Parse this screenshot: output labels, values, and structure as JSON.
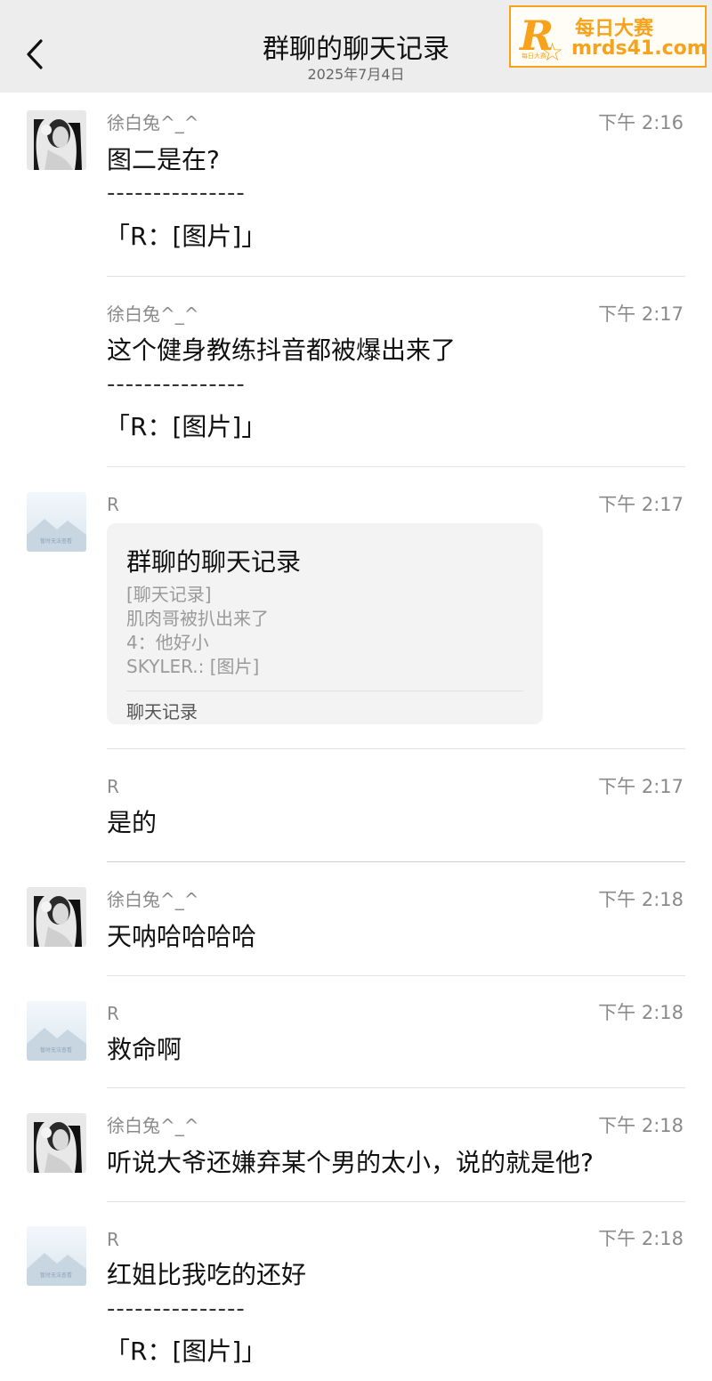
{
  "header": {
    "title": "群聊的聊天记录",
    "date": "2025年7月4日"
  },
  "watermark": {
    "logo_letter": "R",
    "logo_small": "每日大赛",
    "name": "每日大赛",
    "url": "mrds41.com"
  },
  "messages": [
    {
      "sender": "徐白兔^_^",
      "time": "下午 2:16",
      "text": "图二是在?",
      "divider": "---------------",
      "quote": "「R：[图片]」"
    },
    {
      "sender": "徐白兔^_^",
      "time": "下午 2:17",
      "text": "这个健身教练抖音都被爆出来了",
      "divider": "---------------",
      "quote": "「R：[图片]」"
    },
    {
      "sender": "R",
      "time": "下午 2:17",
      "card": {
        "title": "群聊的聊天记录",
        "lines": [
          "[聊天记录]",
          "肌肉哥被扒出来了",
          "4：他好小",
          "SKYLER.: [图片]"
        ],
        "footer": "聊天记录"
      }
    },
    {
      "sender": "R",
      "time": "下午 2:17",
      "text": "是的"
    },
    {
      "sender": "徐白兔^_^",
      "time": "下午 2:18",
      "text": "天呐哈哈哈哈"
    },
    {
      "sender": "R",
      "time": "下午 2:18",
      "text": "救命啊"
    },
    {
      "sender": "徐白兔^_^",
      "time": "下午 2:18",
      "text": "听说大爷还嫌弃某个男的太小，说的就是他?"
    },
    {
      "sender": "R",
      "time": "下午 2:18",
      "text": "红姐比我吃的还好",
      "divider": "---------------",
      "quote": "「R：[图片]」"
    }
  ],
  "avatars": {
    "xu": "portrait-avatar",
    "r": "placeholder-image-avatar",
    "r_caption": "暂时无法查看"
  }
}
